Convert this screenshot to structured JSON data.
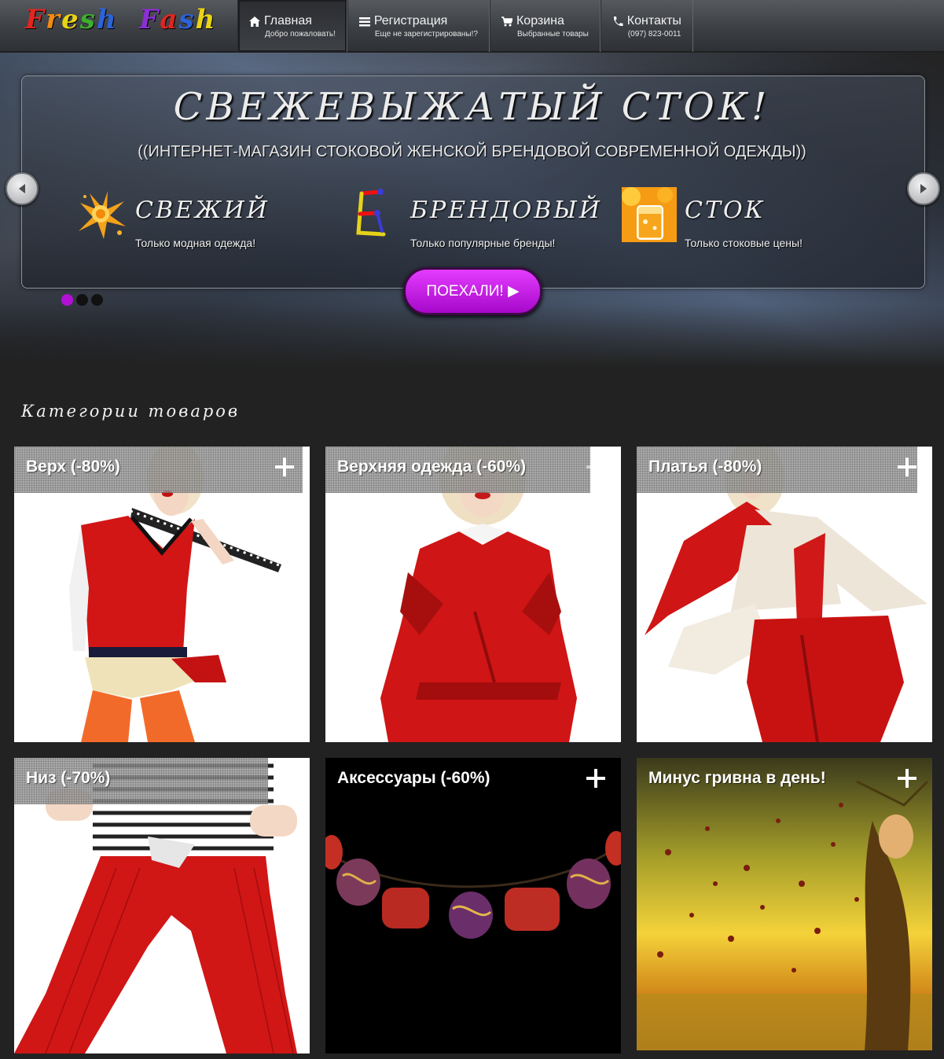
{
  "header": {
    "logo_text": "Fresh Fash",
    "nav": [
      {
        "label": "Главная",
        "sub": "Добро пожаловать!",
        "icon": "home-icon"
      },
      {
        "label": "Регистрация",
        "sub": "Еще не зарегистрированы!?",
        "icon": "list-icon"
      },
      {
        "label": "Корзина",
        "sub": "Выбранные товары",
        "icon": "cart-icon"
      },
      {
        "label": "Контакты",
        "sub": "(097) 823-0011",
        "icon": "phone-icon"
      }
    ],
    "active_nav": "Главная"
  },
  "hero": {
    "title": "СВЕЖЕВЫЖАТЫЙ СТОК!",
    "subtitle": "((ИНТЕРНЕТ-МАГАЗИН СТОКОВОЙ ЖЕНСКОЙ БРЕНДОВОЙ СОВРЕМЕННОЙ ОДЕЖДЫ))",
    "features": [
      {
        "name": "СВЕЖИЙ",
        "desc": "Только модная одежда!",
        "icon": "orange-splash-icon"
      },
      {
        "name": "БРЕНДОВЫЙ",
        "desc": "Только популярные бренды!",
        "icon": "brand-letter-icon"
      },
      {
        "name": "СТОК",
        "desc": "Только стоковые цены!",
        "icon": "orange-juice-icon"
      }
    ],
    "cta_label": "ПОЕХАЛИ! ▶",
    "slides_total": 3,
    "active_slide": 1
  },
  "categories": {
    "title": "Категории товаров",
    "items": [
      {
        "label": "Верх (-80%)"
      },
      {
        "label": "Верхняя одежда (-60%)"
      },
      {
        "label": "Платья (-80%)"
      },
      {
        "label": "Низ (-70%)"
      },
      {
        "label": "Аксессуары (-60%)"
      },
      {
        "label": "Минус гривна в день!"
      }
    ]
  },
  "colors": {
    "accent": "#b310d6",
    "background": "#222222",
    "garment_red": "#d01818"
  }
}
